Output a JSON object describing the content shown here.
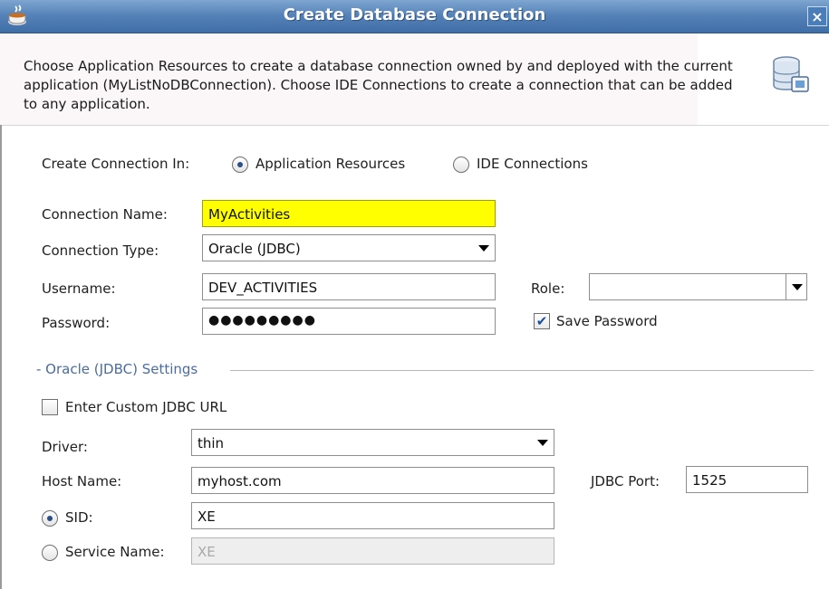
{
  "window": {
    "title": "Create Database Connection",
    "close_glyph": "×",
    "icon": "coffee-cup-icon"
  },
  "header": {
    "description": "Choose Application Resources to create a database connection owned by and deployed with the current application (MyListNoDBConnection). Choose IDE Connections to create a connection that can be added to any application.",
    "icon": "database-icon"
  },
  "create_in": {
    "label": "Create Connection In:",
    "options": [
      {
        "label": "Application Resources",
        "selected": true
      },
      {
        "label": "IDE Connections",
        "selected": false
      }
    ]
  },
  "connection": {
    "name_label": "Connection Name:",
    "name_value": "MyActivities",
    "type_label": "Connection Type:",
    "type_value": "Oracle (JDBC)",
    "username_label": "Username:",
    "username_value": "DEV_ACTIVITIES",
    "role_label": "Role:",
    "role_value": "",
    "password_label": "Password:",
    "password_value": "●●●●●●●●●",
    "save_password_label": "Save Password",
    "save_password_checked": true
  },
  "jdbc": {
    "section_title": "- Oracle (JDBC) Settings",
    "custom_url_label": "Enter Custom JDBC URL",
    "custom_url_checked": false,
    "driver_label": "Driver:",
    "driver_value": "thin",
    "host_label": "Host Name:",
    "host_value": "myhost.com",
    "port_label": "JDBC Port:",
    "port_value": "1525",
    "sid_label": "SID:",
    "sid_value": "XE",
    "sid_selected": true,
    "service_label": "Service Name:",
    "service_value": "XE",
    "service_selected": false
  },
  "colors": {
    "titlebar": "#5683b8",
    "highlight_field": "#ffff00",
    "section_title": "#4a6ca0"
  }
}
